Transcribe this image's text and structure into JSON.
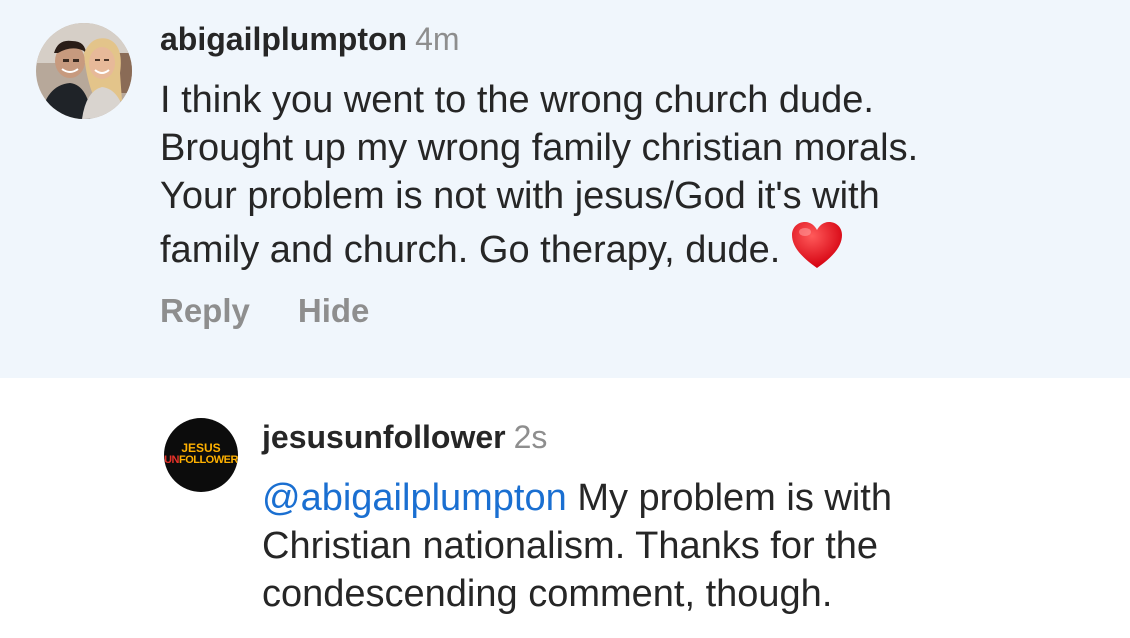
{
  "comment": {
    "username": "abigailplumpton",
    "time": "4m",
    "text_lines": [
      "I think you went to the wrong church dude.",
      "Brought up my wrong family christian morals.",
      "Your problem is not with jesus/God it's with",
      "family and church. Go therapy, dude."
    ],
    "emoji": "red-heart",
    "actions": {
      "reply": "Reply",
      "hide": "Hide"
    },
    "background": "#f0f6fc"
  },
  "reply": {
    "avatar_logo": {
      "line1": "JESUS",
      "line2a": "UN",
      "line2b": "FOLLOWER"
    },
    "username": "jesusunfollower",
    "time": "2s",
    "mention": "@abigailplumpton",
    "text_first": " My problem is with",
    "text_lines": [
      "Christian nationalism. Thanks for the",
      "condescending comment, though."
    ],
    "mention_color": "#1a6fd1"
  }
}
